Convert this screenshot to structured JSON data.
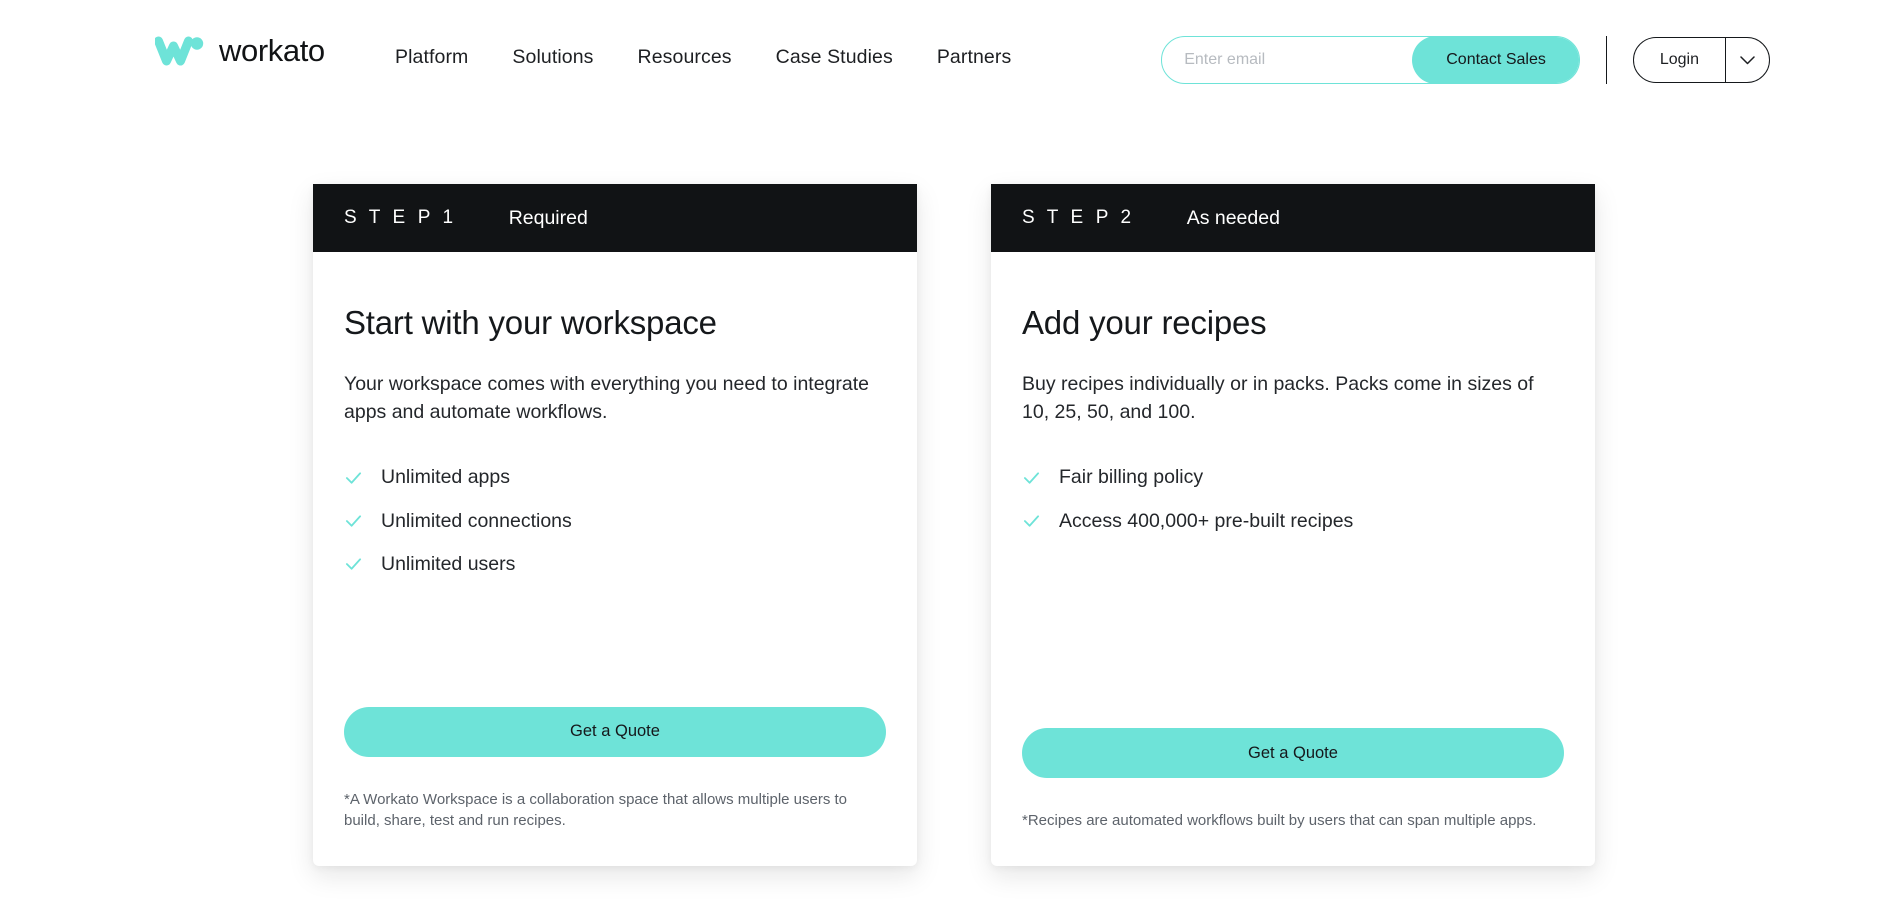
{
  "header": {
    "brand_name": "workato",
    "brand_logo_icon": "workato-w-logo",
    "nav": [
      {
        "label": "Platform"
      },
      {
        "label": "Solutions"
      },
      {
        "label": "Resources"
      },
      {
        "label": "Case Studies"
      },
      {
        "label": "Partners"
      }
    ],
    "email_placeholder": "Enter email",
    "email_value": "",
    "contact_sales_label": "Contact Sales",
    "login_label": "Login",
    "login_caret_icon": "chevron-down-icon"
  },
  "colors": {
    "accent_teal": "#6ee3d8",
    "dark": "#111315",
    "body_text": "#24272b",
    "muted_text": "#5d636b"
  },
  "cards": [
    {
      "step_label": "S T E P  1",
      "step_tag": "Required",
      "title": "Start with your workspace",
      "description": "Your workspace comes with everything you need to integrate apps and automate workflows.",
      "features": [
        {
          "label": "Unlimited apps",
          "icon": "check-icon"
        },
        {
          "label": "Unlimited connections",
          "icon": "check-icon"
        },
        {
          "label": "Unlimited users",
          "icon": "check-icon"
        }
      ],
      "cta_label": "Get a Quote",
      "footnote": "*A Workato Workspace is a collaboration space that allows multiple users to build, share, test and run recipes."
    },
    {
      "step_label": "S T E P  2",
      "step_tag": "As needed",
      "title": "Add your recipes",
      "description": "Buy recipes individually or in packs. Packs come in sizes of 10, 25, 50, and 100.",
      "features": [
        {
          "label": "Fair billing policy",
          "icon": "check-icon"
        },
        {
          "label": "Access 400,000+ pre-built recipes",
          "icon": "check-icon"
        }
      ],
      "cta_label": "Get a Quote",
      "footnote": "*Recipes are automated workflows built by users that can span multiple apps."
    }
  ]
}
